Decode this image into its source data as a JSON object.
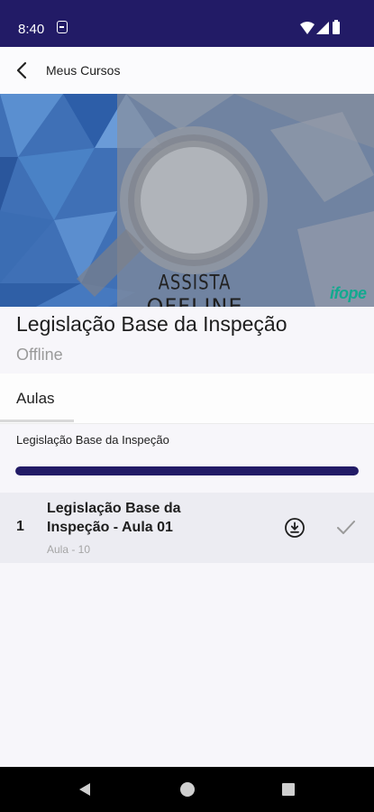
{
  "status_bar": {
    "time": "8:40",
    "icons": [
      "notification-b-icon",
      "wifi-icon",
      "signal-icon",
      "battery-icon"
    ]
  },
  "app_bar": {
    "title": "Meus Cursos",
    "back_icon": "chevron-left-icon"
  },
  "banner": {
    "line1": "ASSISTA",
    "line2": "OFFLINE",
    "logo_text": "ifope"
  },
  "course": {
    "title": "Legislação Base da Inspeção",
    "subtitle": "Offline"
  },
  "tabs": [
    {
      "label": "Aulas",
      "selected": true
    }
  ],
  "section": {
    "label": "Legislação Base da Inspeção",
    "progress": 1.0
  },
  "lessons": [
    {
      "number": "1",
      "title": "Legislação Base da Inspeção - Aula 01",
      "meta": "Aula - 10",
      "icons": [
        "download-icon",
        "check-icon"
      ]
    }
  ],
  "colors": {
    "primary": "#221b66",
    "banner_blue": "#3d6fb4",
    "logo_green": "#13a98f"
  },
  "nav_bar": {
    "icons": [
      "back-triangle-icon",
      "home-circle-icon",
      "recents-square-icon"
    ]
  }
}
